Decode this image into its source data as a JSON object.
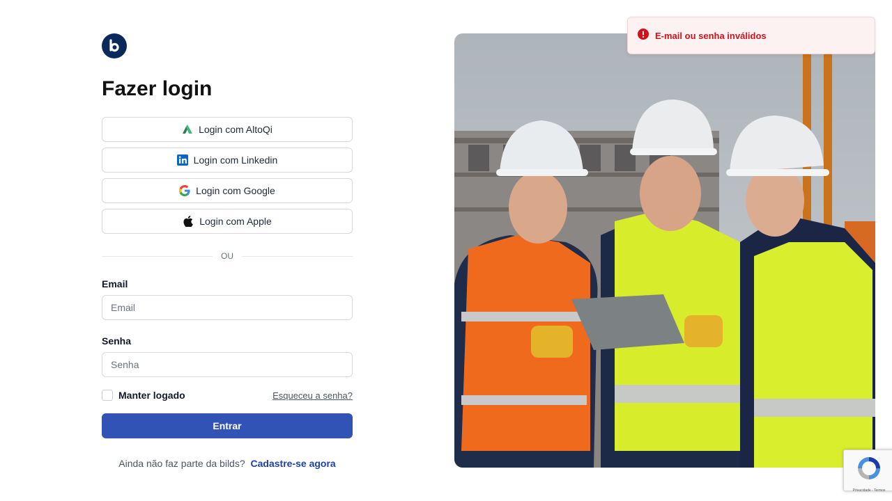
{
  "brand": {
    "logo_letter": "b",
    "logo_color": "#0b2a5b"
  },
  "page": {
    "title": "Fazer login"
  },
  "sso": [
    {
      "label": "Login com AltoQi",
      "icon": "altoqi-icon"
    },
    {
      "label": "Login com Linkedin",
      "icon": "linkedin-icon"
    },
    {
      "label": "Login com Google",
      "icon": "google-icon"
    },
    {
      "label": "Login com Apple",
      "icon": "apple-icon"
    }
  ],
  "divider": "OU",
  "form": {
    "email_label": "Email",
    "email_placeholder": "Email",
    "email_value": "",
    "password_label": "Senha",
    "password_placeholder": "Senha",
    "password_value": "",
    "remember_label": "Manter logado",
    "remember_checked": false,
    "forgot_label": "Esqueceu a senha?",
    "submit_label": "Entrar"
  },
  "signup": {
    "prompt": "Ainda não faz parte da bilds?",
    "link": "Cadastre-se agora"
  },
  "toast": {
    "message": "E-mail ou senha inválidos",
    "icon": "error-icon",
    "color": "#d0121b"
  },
  "recaptcha": {
    "text": "Privacidade - Termos"
  },
  "colors": {
    "primary": "#3253b6",
    "link": "#1e40af",
    "error": "#d0121b"
  }
}
